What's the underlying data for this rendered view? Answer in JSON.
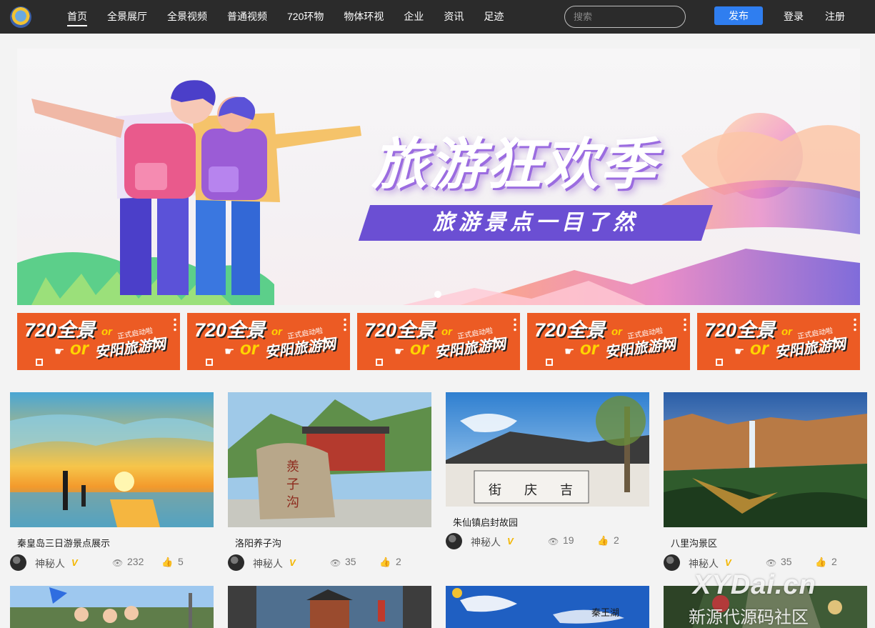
{
  "nav": {
    "items": [
      "首页",
      "全景展厅",
      "全景视频",
      "普通视频",
      "720环物",
      "物体环视",
      "企业",
      "资讯",
      "足迹"
    ],
    "active_index": 0
  },
  "search": {
    "placeholder": "搜索",
    "value": ""
  },
  "actions": {
    "publish": "发布",
    "login": "登录",
    "register": "注册"
  },
  "colors": {
    "header_bg": "#2b2b2b",
    "accent": "#2f7ef0",
    "ad_bg": "#ec5b24",
    "banner_purple": "#6b4fd3"
  },
  "banner": {
    "title": "旅游狂欢季",
    "subtitle": "旅游景点一目了然",
    "slide_count": 1,
    "active_slide": 0
  },
  "ads": [
    {
      "line1": "720全景",
      "or1": "or",
      "note": "正式启动啦",
      "or2": "or",
      "line2": "安阳旅游网"
    },
    {
      "line1": "720全景",
      "or1": "or",
      "note": "正式启动啦",
      "or2": "or",
      "line2": "安阳旅游网"
    },
    {
      "line1": "720全景",
      "or1": "or",
      "note": "正式启动啦",
      "or2": "or",
      "line2": "安阳旅游网"
    },
    {
      "line1": "720全景",
      "or1": "or",
      "note": "正式启动啦",
      "or2": "or",
      "line2": "安阳旅游网"
    },
    {
      "line1": "720全景",
      "or1": "or",
      "note": "正式启动啦",
      "or2": "or",
      "line2": "安阳旅游网"
    }
  ],
  "cards": [
    {
      "title": "秦皇岛三日游景点展示",
      "author": "神秘人",
      "badge": "V",
      "views": "232",
      "likes": "5",
      "scene": "beach-sunset-photo"
    },
    {
      "title": "洛阳养子沟",
      "author": "神秘人",
      "badge": "V",
      "views": "35",
      "likes": "2",
      "scene": "stone-gate-mountain-photo"
    },
    {
      "title": "朱仙镇启封故园",
      "author": "神秘人",
      "badge": "V",
      "views": "19",
      "likes": "2",
      "scene": "ancient-street-photo"
    },
    {
      "title": "八里沟景区",
      "author": "神秘人",
      "badge": "V",
      "views": "35",
      "likes": "2",
      "scene": "canyon-waterfall-photo"
    }
  ],
  "partial_cards": [
    {
      "scene": "tourists-flags-photo"
    },
    {
      "scene": "pavilion-archway-photo"
    },
    {
      "scene": "lake-blue-sky-photo",
      "label": "秦王湖"
    },
    {
      "scene": "forest-path-photo"
    }
  ],
  "watermark": {
    "line1": "XYDai.cn",
    "line2": "新源代源码社区"
  }
}
